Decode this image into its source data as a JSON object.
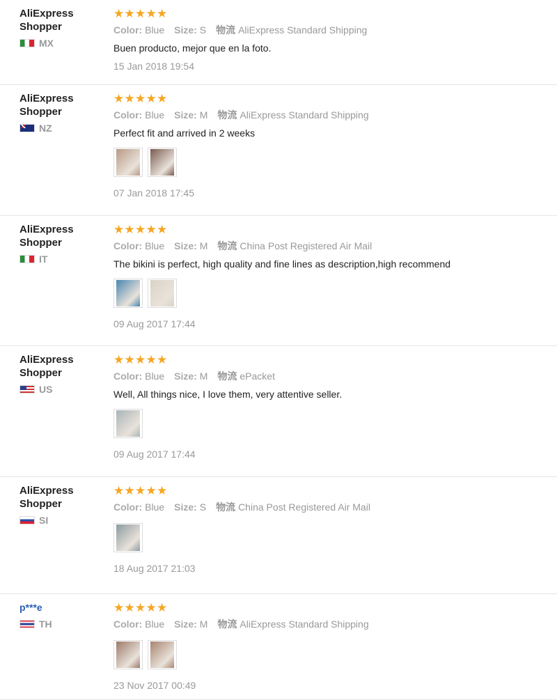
{
  "labels": {
    "color": "Color:",
    "size": "Size:",
    "shipping_icon": "物流"
  },
  "reviews": [
    {
      "user": "AliExpress Shopper",
      "country": "MX",
      "flag": "mx",
      "rating": 5,
      "color": "Blue",
      "size": "S",
      "shipping": "AliExpress Standard Shipping",
      "text": "Buen producto, mejor que en la foto.",
      "photos": [],
      "date": "15 Jan 2018 19:54"
    },
    {
      "user": "AliExpress Shopper",
      "country": "NZ",
      "flag": "nz",
      "rating": 5,
      "color": "Blue",
      "size": "M",
      "shipping": "AliExpress Standard Shipping",
      "text": "Perfect fit and arrived in 2 weeks",
      "photos": [
        "#b89a86",
        "#7a5a4e"
      ],
      "date": "07 Jan 2018 17:45"
    },
    {
      "user": "AliExpress Shopper",
      "country": "IT",
      "flag": "it",
      "rating": 5,
      "color": "Blue",
      "size": "M",
      "shipping": "China Post Registered Air Mail",
      "text": "The bikini is perfect, high quality and fine lines as description,high recommend",
      "photos": [
        "#4a86b0",
        "#d9d3c6"
      ],
      "date": "09 Aug 2017 17:44"
    },
    {
      "user": "AliExpress Shopper",
      "country": "US",
      "flag": "us",
      "rating": 5,
      "color": "Blue",
      "size": "M",
      "shipping": "ePacket",
      "text": "Well, All things nice, I love them, very attentive seller.",
      "photos": [
        "#a9b4b8"
      ],
      "date": "09 Aug 2017 17:44"
    },
    {
      "user": "AliExpress Shopper",
      "country": "SI",
      "flag": "si",
      "rating": 5,
      "color": "Blue",
      "size": "S",
      "shipping": "China Post Registered Air Mail",
      "text": "",
      "photos": [
        "#8c9aa0"
      ],
      "date": "18 Aug 2017 21:03"
    },
    {
      "user": "p***e",
      "country": "TH",
      "flag": "th",
      "rating": 5,
      "color": "Blue",
      "size": "M",
      "shipping": "AliExpress Standard Shipping",
      "text": "",
      "photos": [
        "#9c7b6a",
        "#a88570"
      ],
      "date": "23 Nov 2017 00:49"
    }
  ]
}
